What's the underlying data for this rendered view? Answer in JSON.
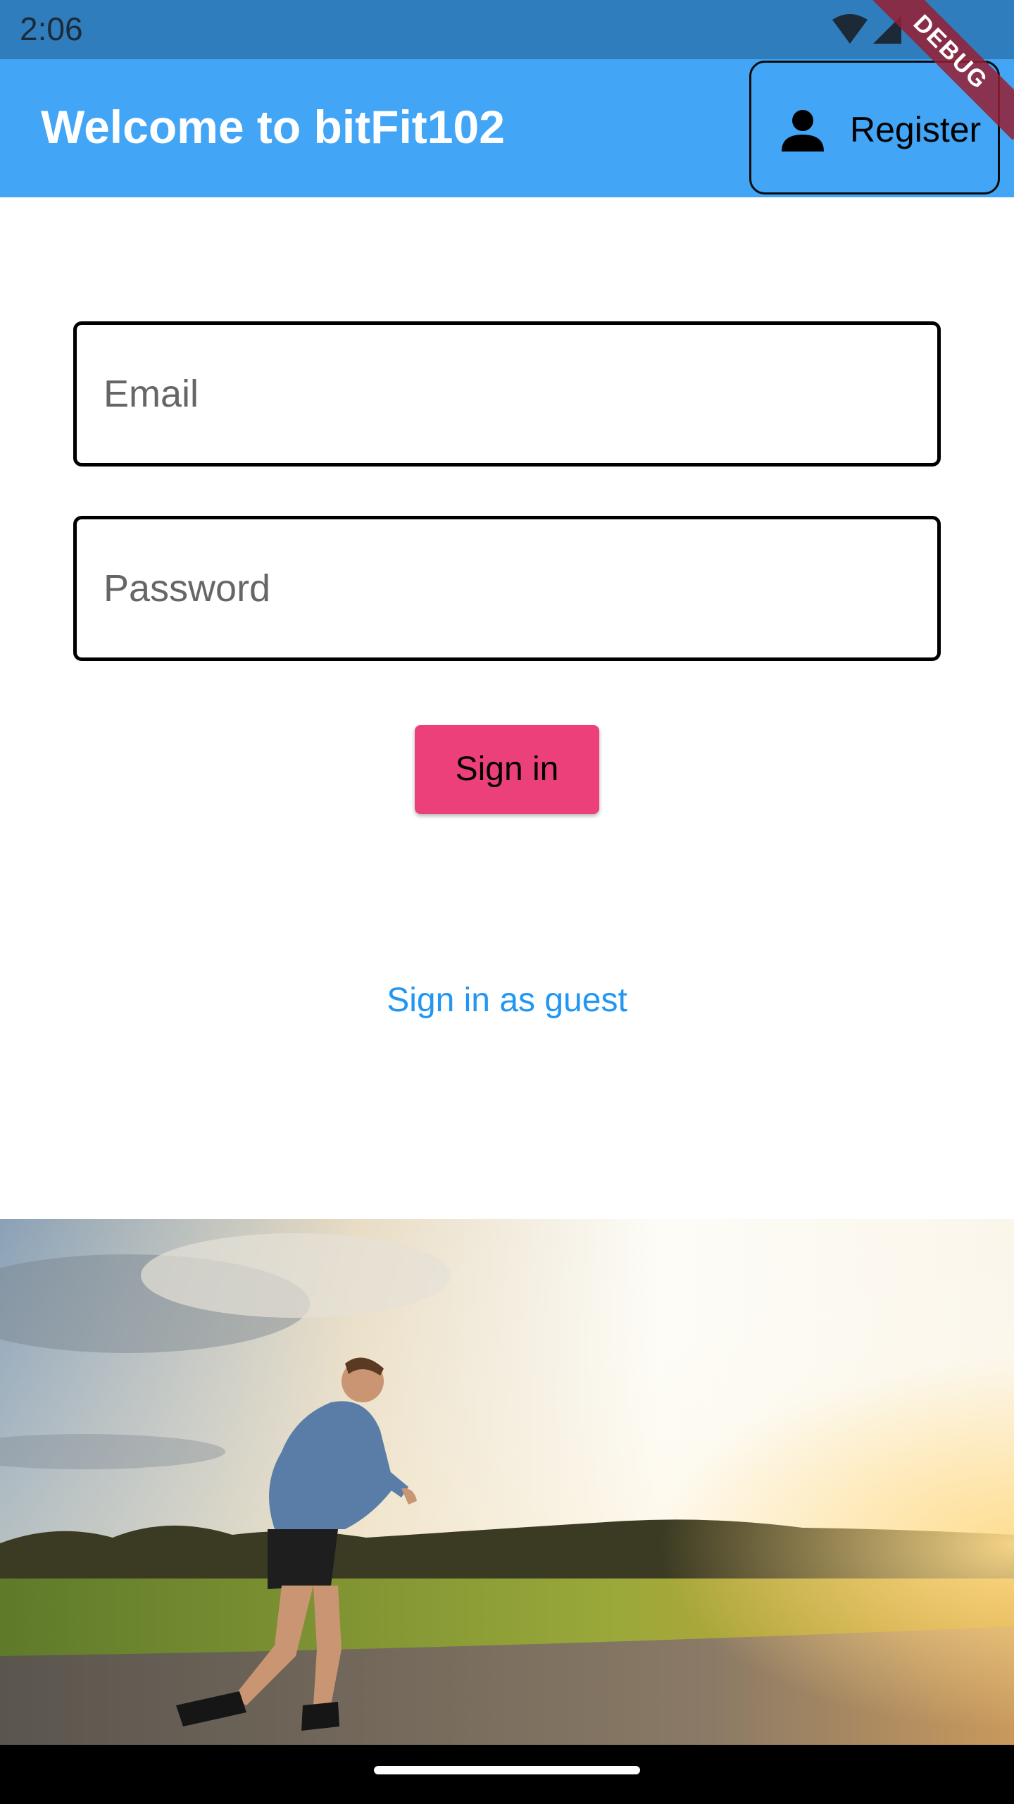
{
  "status_bar": {
    "time": "2:06",
    "icons": [
      "wifi-icon",
      "cellular-signal-icon"
    ]
  },
  "app_bar": {
    "title": "Welcome to bitFit102",
    "register_label": "Register",
    "register_icon": "person-icon",
    "color": "#42a5f5"
  },
  "debug_banner": "DEBUG",
  "form": {
    "email_placeholder": "Email",
    "email_value": "",
    "password_placeholder": "Password",
    "password_value": "",
    "signin_label": "Sign in",
    "signin_color": "#ec407a"
  },
  "guest_link": {
    "label": "Sign in as guest",
    "color": "#2196f3"
  },
  "hero": {
    "icon": "runner-photo"
  }
}
